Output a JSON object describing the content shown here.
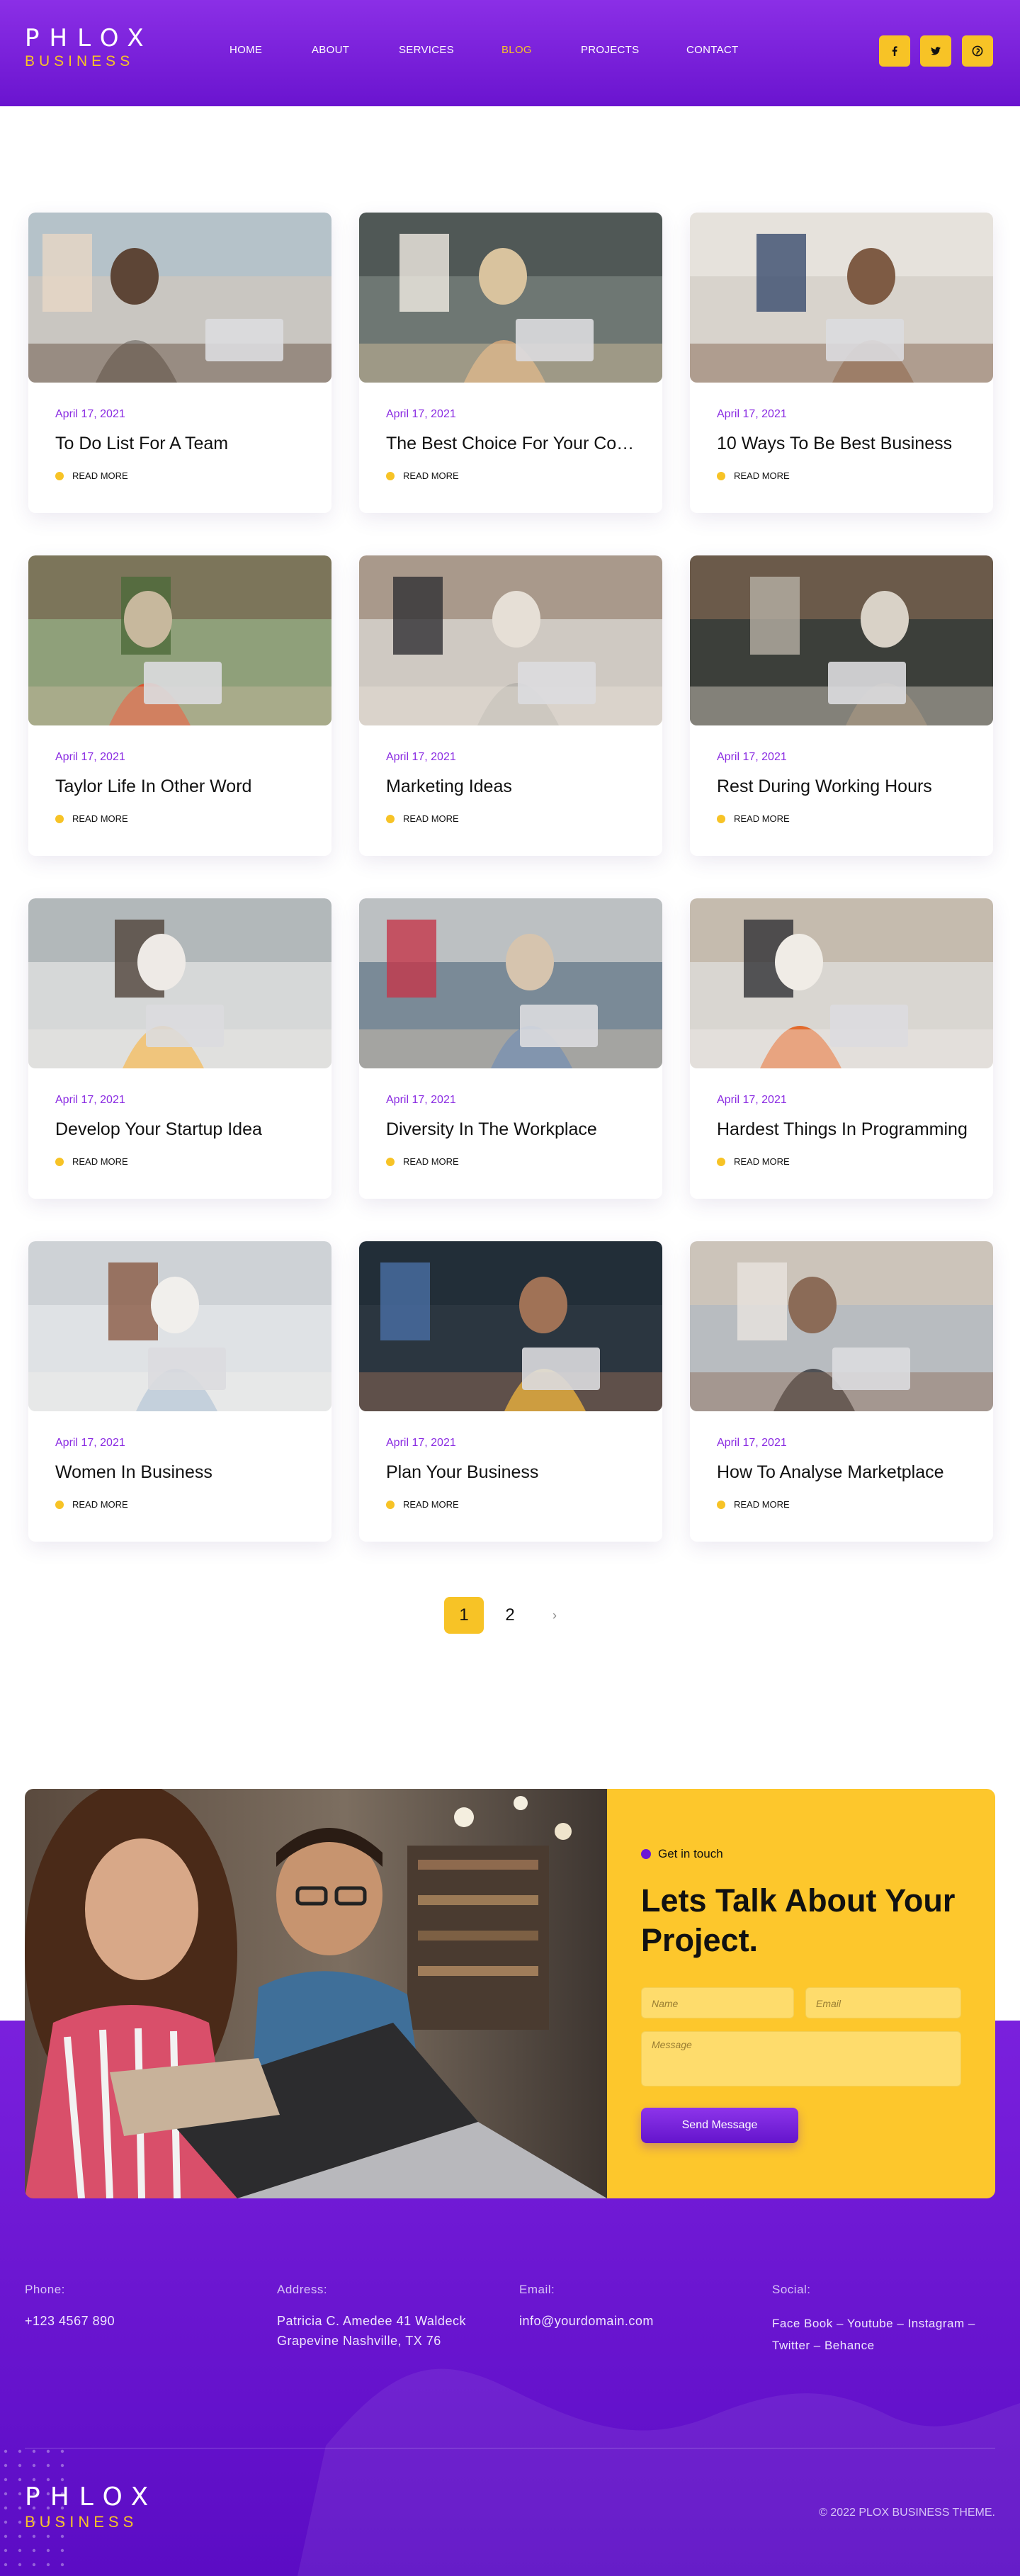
{
  "header": {
    "logo_word1": "PHLOX",
    "logo_word2": "BUSINESS",
    "nav": [
      "HOME",
      "ABOUT",
      "SERVICES",
      "BLOG",
      "PROJECTS",
      "CONTACT"
    ],
    "active_nav": "BLOG",
    "social_icons": [
      "facebook-icon",
      "twitter-icon",
      "pinterest-icon"
    ]
  },
  "posts": [
    {
      "date": "April 17, 2021",
      "title": "To Do List For A Team",
      "more": "READ MORE"
    },
    {
      "date": "April 17, 2021",
      "title": "The Best Choice For Your Company",
      "more": "READ MORE"
    },
    {
      "date": "April 17, 2021",
      "title": "10 Ways To Be Best Business",
      "more": "READ MORE"
    },
    {
      "date": "April 17, 2021",
      "title": "Taylor Life In Other Word",
      "more": "READ MORE"
    },
    {
      "date": "April 17, 2021",
      "title": "Marketing Ideas",
      "more": "READ MORE"
    },
    {
      "date": "April 17, 2021",
      "title": "Rest During Working Hours",
      "more": "READ MORE"
    },
    {
      "date": "April 17, 2021",
      "title": "Develop Your Startup Idea",
      "more": "READ MORE"
    },
    {
      "date": "April 17, 2021",
      "title": "Diversity In The Workplace",
      "more": "READ MORE"
    },
    {
      "date": "April 17, 2021",
      "title": "Hardest Things In Programming",
      "more": "READ MORE"
    },
    {
      "date": "April 17, 2021",
      "title": "Women In Business",
      "more": "READ MORE"
    },
    {
      "date": "April 17, 2021",
      "title": "Plan Your Business",
      "more": "READ MORE"
    },
    {
      "date": "April 17, 2021",
      "title": "How To Analyse Marketplace",
      "more": "READ MORE"
    }
  ],
  "pagination": {
    "page1": "1",
    "page2": "2",
    "next": "›"
  },
  "contact": {
    "eyebrow": "Get in touch",
    "title": "Lets Talk About Your Project.",
    "name_placeholder": "Name",
    "email_placeholder": "Email",
    "message_placeholder": "Message",
    "send_label": "Send Message"
  },
  "footer": {
    "phone_label": "Phone:",
    "phone": "+123 4567 890",
    "address_label": "Address:",
    "address_line1": "Patricia C. Amedee 41 Waldeck",
    "address_line2": "Grapevine Nashville, TX 76",
    "email_label": "Email:",
    "email": "info@yourdomain.com",
    "social_label": "Social:",
    "social_line1": "Face Book – Youtube – Instagram –",
    "social_line2": "Twitter – Behance",
    "logo_word1": "PHLOX",
    "logo_word2": "BUSINESS",
    "copyright": "© 2022 PLOX BUSINESS THEME."
  },
  "colors": {
    "purple": "#7a20dd",
    "yellow": "#f7c326",
    "date": "#8a2be2"
  }
}
